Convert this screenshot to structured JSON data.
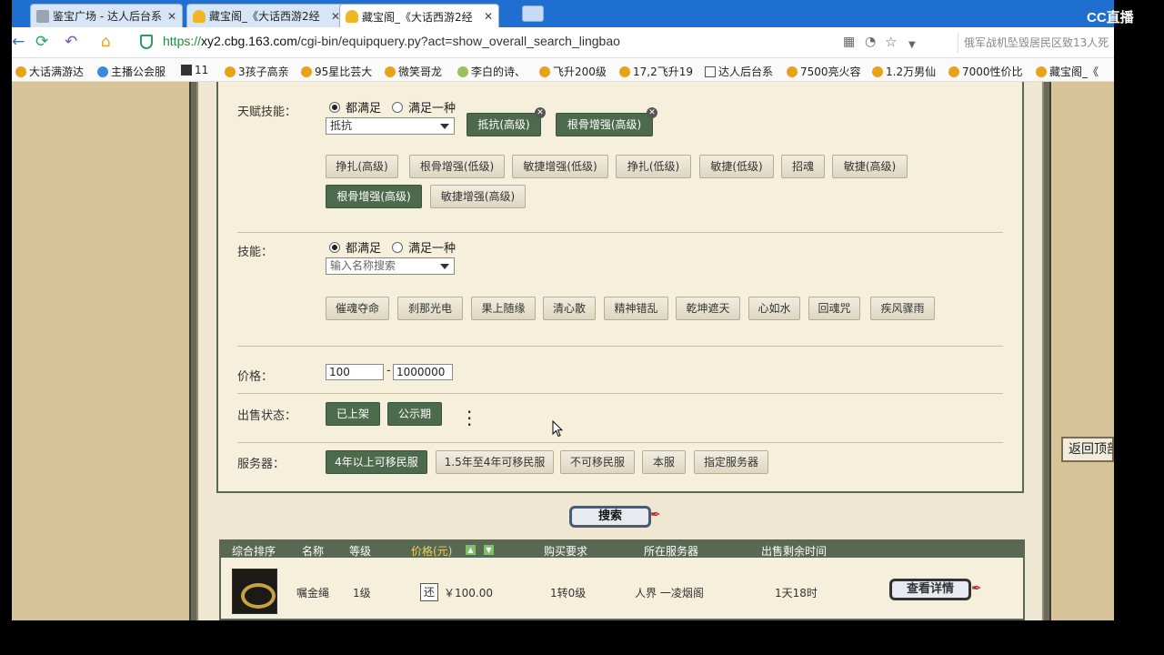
{
  "browser": {
    "tabs": [
      {
        "title": "鉴宝广场 - 达人后台系",
        "icon": "document-icon",
        "close": "✕"
      },
      {
        "title": "藏宝阁_《大话西游2经",
        "icon": "ingot-icon",
        "close": "✕"
      },
      {
        "title": "藏宝阁_《大话西游2经",
        "icon": "ingot-icon",
        "close": "✕"
      }
    ],
    "overlay_logo": "CC直播",
    "url_scheme": "https://",
    "url_domain": "xy2.cbg.163.com",
    "url_path": "/cgi-bin/equipquery.py?act=show_overall_search_lingbao",
    "right_search": "俄军战机坠毁居民区致13人死",
    "bookmarks": [
      "大话满游达",
      "主播公会服",
      "11",
      "3孩子高亲",
      "95星比芸大",
      "微笑哥龙",
      "李白的诗、",
      "飞升200级",
      "17,2飞升19",
      "达人后台系",
      "7500亮火容",
      "1.2万男仙",
      "7000性价比",
      "藏宝阁_《"
    ]
  },
  "talent": {
    "label": "天赋技能：",
    "radio_all": "都满足",
    "radio_any": "满足一种",
    "select_value": "抵抗",
    "chosen": [
      "抵抗(高级)",
      "根骨增强(高级)"
    ],
    "options_row1": [
      "挣扎(高级)",
      "根骨增强(低级)",
      "敏捷增强(低级)",
      "挣扎(低级)",
      "敏捷(低级)",
      "招魂",
      "敏捷(高级)"
    ],
    "options_row2": [
      "根骨增强(高级)",
      "敏捷增强(高级)"
    ]
  },
  "skills": {
    "label": "技能：",
    "radio_all": "都满足",
    "radio_any": "满足一种",
    "select_placeholder": "输入名称搜索",
    "options": [
      "催魂夺命",
      "刹那光电",
      "果上随缘",
      "清心散",
      "精神错乱",
      "乾坤遮天",
      "心如水",
      "回魂咒",
      "疾风骤雨"
    ]
  },
  "price": {
    "label": "价格：",
    "min": "100",
    "dash": "-",
    "max": "1000000"
  },
  "sale": {
    "label": "出售状态：",
    "options": [
      "已上架",
      "公示期"
    ]
  },
  "server": {
    "label": "服务器：",
    "options": [
      "4年以上可移民服",
      "1.5年至4年可移民服",
      "不可移民服",
      "本服",
      "指定服务器"
    ]
  },
  "search_button": "搜索",
  "back_top": "返回顶部",
  "results": {
    "headers": [
      "综合排序",
      "名称",
      "等级",
      "价格(元)",
      "购买要求",
      "所在服务器",
      "出售剩余时间"
    ],
    "row": {
      "name": "嘱金绳",
      "level": "1级",
      "return_badge": "还",
      "price": "￥100.00",
      "requirement": "1转0级",
      "server": "人界  一凌烟阁",
      "remaining": "1天18时",
      "detail_button": "查看详情"
    }
  }
}
